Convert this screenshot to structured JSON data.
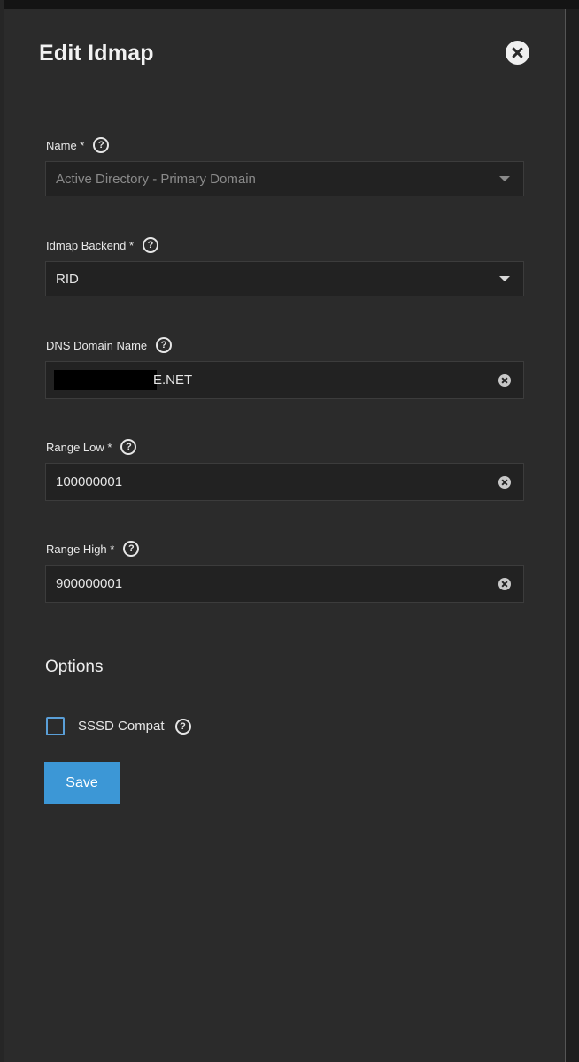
{
  "dialog": {
    "title": "Edit Idmap"
  },
  "form": {
    "name": {
      "label": "Name *",
      "value": "Active Directory - Primary Domain"
    },
    "backend": {
      "label": "Idmap Backend *",
      "value": "RID"
    },
    "dns_domain": {
      "label": "DNS Domain Name",
      "value_visible": "E.NET"
    },
    "range_low": {
      "label": "Range Low *",
      "value": "100000001"
    },
    "range_high": {
      "label": "Range High *",
      "value": "900000001"
    }
  },
  "options": {
    "heading": "Options",
    "sssd_compat": {
      "label": "SSSD Compat",
      "checked": false
    }
  },
  "actions": {
    "save_label": "Save"
  },
  "colors": {
    "accent": "#3c97d6",
    "panel": "#2b2b2b",
    "field": "#222222",
    "checkbox_border": "#5a9fd8"
  }
}
